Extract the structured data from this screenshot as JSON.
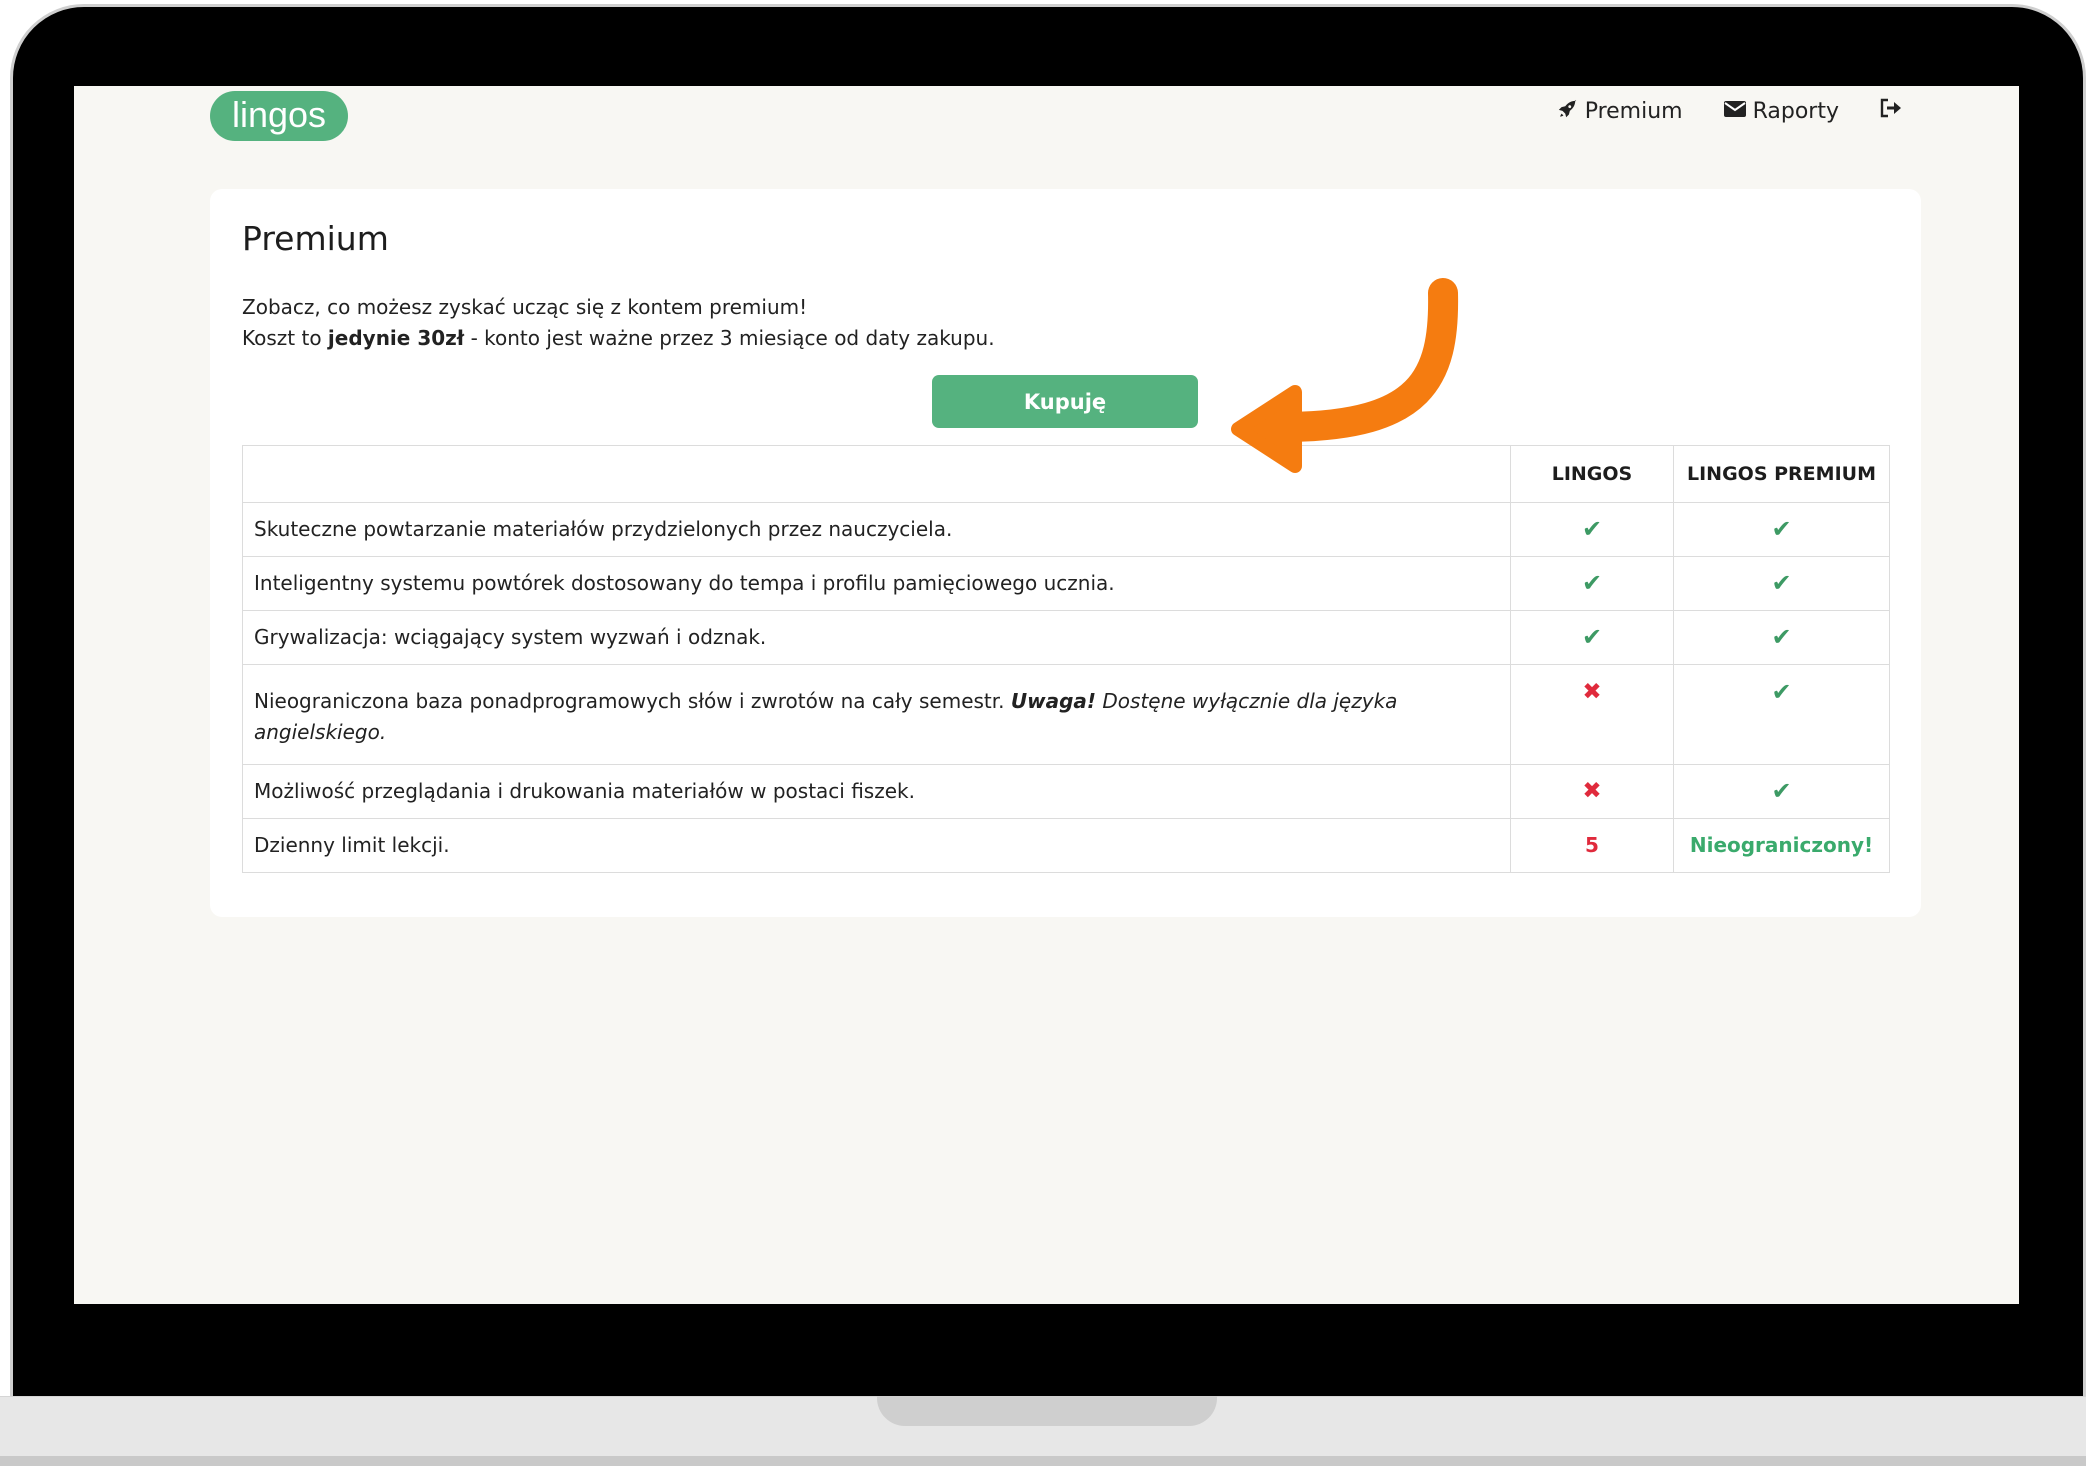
{
  "logo": {
    "text": "lingos"
  },
  "nav": {
    "premium": {
      "label": "Premium",
      "icon": "rocket-icon"
    },
    "reports": {
      "label": "Raporty",
      "icon": "envelope-icon"
    },
    "logout": {
      "icon": "logout-icon"
    }
  },
  "card": {
    "title": "Premium",
    "intro_line1": "Zobacz, co możesz zyskać ucząc się z kontem premium!",
    "intro_line2_prefix": "Koszt to ",
    "intro_line2_bold": "jedynie 30zł",
    "intro_line2_suffix": " - konto jest ważne przez 3 miesiące od daty zakupu.",
    "buy_label": "Kupuję"
  },
  "table": {
    "headers": [
      "",
      "LINGOS",
      "LINGOS PREMIUM"
    ],
    "rows": [
      {
        "feature": "Skuteczne powtarzanie materiałów przydzielonych przez nauczyciela.",
        "lingos": "✔",
        "premium": "✔"
      },
      {
        "feature": "Inteligentny systemu powtórek dostosowany do tempa i profilu pamięciowego ucznia.",
        "lingos": "✔",
        "premium": "✔"
      },
      {
        "feature": "Grywalizacja: wciągający system wyzwań i odznak.",
        "lingos": "✔",
        "premium": "✔"
      },
      {
        "feature": "Nieograniczona baza ponadprogramowych słów i zwrotów na cały semestr. ",
        "note_strong": "Uwaga!",
        "note_em": " Dostęne wyłącznie dla języka angielskiego.",
        "lingos": "✖",
        "premium": "✔"
      },
      {
        "feature": "Możliwość przeglądania i drukowania materiałów w postaci fiszek.",
        "lingos": "✖",
        "premium": "✔"
      },
      {
        "feature": "Dzienny limit lekcji.",
        "lingos": "5",
        "premium": "Nieograniczony!"
      }
    ]
  },
  "colors": {
    "brand_green": "#55b27f",
    "check_green": "#3d9a64",
    "cross_red": "#e02a3c",
    "arrow_orange": "#f57c10"
  }
}
